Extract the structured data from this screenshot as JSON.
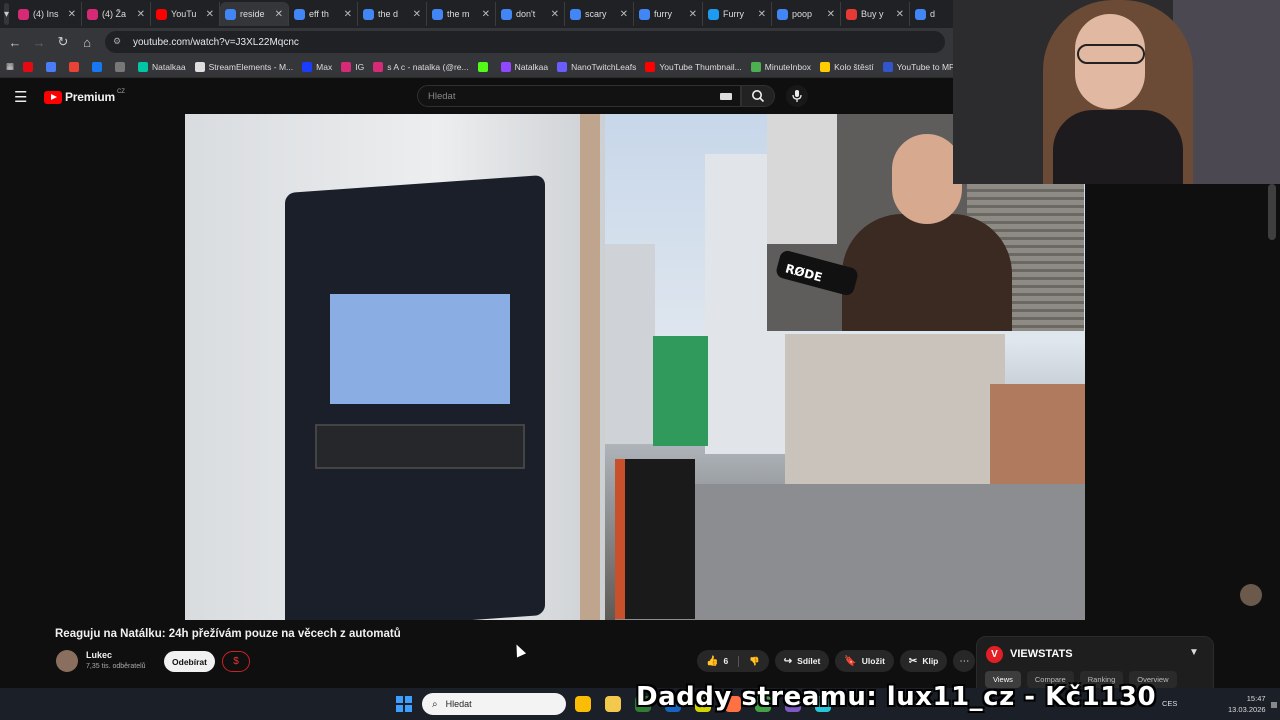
{
  "browser": {
    "tabs": [
      {
        "label": "(4) Ins",
        "color": "#d62976"
      },
      {
        "label": "(4) Ža",
        "color": "#d62976"
      },
      {
        "label": "YouTu",
        "color": "#ff0000"
      },
      {
        "label": "reside",
        "color": "#4285f4",
        "active": true
      },
      {
        "label": "eff th",
        "color": "#4285f4"
      },
      {
        "label": "the d",
        "color": "#4285f4"
      },
      {
        "label": "the m",
        "color": "#4285f4"
      },
      {
        "label": "don't",
        "color": "#4285f4"
      },
      {
        "label": "scary",
        "color": "#4285f4"
      },
      {
        "label": "furry",
        "color": "#4285f4"
      },
      {
        "label": "Furry",
        "color": "#1d9bf0"
      },
      {
        "label": "poop",
        "color": "#4285f4"
      },
      {
        "label": "Buy y",
        "color": "#e53935"
      },
      {
        "label": "d",
        "color": "#4285f4"
      }
    ],
    "url": "youtube.com/watch?v=J3XL22Mqcnc",
    "bookmarks": [
      {
        "label": "",
        "color": "#e50914"
      },
      {
        "label": "",
        "color": "#4a7cf7"
      },
      {
        "label": "",
        "color": "#ea4335"
      },
      {
        "label": "",
        "color": "#1877f2"
      },
      {
        "label": "",
        "color": "#777777"
      },
      {
        "label": "Natalkaa",
        "color": "#00c6a7"
      },
      {
        "label": "StreamElements - M...",
        "color": "#dddddd"
      },
      {
        "label": "Max",
        "color": "#1a3cff"
      },
      {
        "label": "IG",
        "color": "#d62976"
      },
      {
        "label": "s A c - natalka (@re...",
        "color": "#d62976"
      },
      {
        "label": "",
        "color": "#53fc18"
      },
      {
        "label": "Natalkaa",
        "color": "#9146ff"
      },
      {
        "label": "NanoTwitchLeafs",
        "color": "#6b5cff"
      },
      {
        "label": "YouTube Thumbnail...",
        "color": "#ff0000"
      },
      {
        "label": "MinuteInbox",
        "color": "#4caf50"
      },
      {
        "label": "Kolo štěstí",
        "color": "#ffcc00"
      },
      {
        "label": "YouTube to MP...",
        "color": "#3355cc"
      }
    ]
  },
  "youtube": {
    "brand": "Premium",
    "region": "CZ",
    "search_placeholder": "Hledat",
    "video_title": "Reaguju na Natálku: 24h přežívám pouze na věcech z automatů",
    "channel_name": "Lukec",
    "subscriber_count": "7,35 tis. odběratelů",
    "subscribe_label": "Odebírat",
    "donate_symbol": "$",
    "like_count": "6",
    "share_label": "Sdílet",
    "save_label": "Uložit",
    "clip_label": "Klip",
    "more_symbol": "⋯"
  },
  "facecam": {
    "mic_brand": "RØDE"
  },
  "viewstats": {
    "logo_letter": "V",
    "title": "VIEWSTATS",
    "tabs": [
      "Views",
      "Compare",
      "Ranking",
      "Overview"
    ],
    "active_tab": "Views"
  },
  "taskbar": {
    "search_placeholder": "Hledat",
    "language": "CES",
    "time": "15:47",
    "date": "13.03.2026",
    "apps": [
      {
        "name": "chrome-icon",
        "color": "#fbbc05"
      },
      {
        "name": "file-explorer-icon",
        "color": "#f2c94c"
      },
      {
        "name": "app-icon",
        "color": "#2e7d32"
      },
      {
        "name": "app-icon",
        "color": "#1565c0"
      },
      {
        "name": "app-icon",
        "color": "#d4d400"
      },
      {
        "name": "app-icon",
        "color": "#ff7043"
      },
      {
        "name": "app-icon",
        "color": "#43a047"
      },
      {
        "name": "app-icon",
        "color": "#7e57c2"
      },
      {
        "name": "app-icon",
        "color": "#26c6da"
      }
    ]
  },
  "overlay": {
    "ticker_text": "Daddy streamu: lux11_cz - Kč1130"
  }
}
